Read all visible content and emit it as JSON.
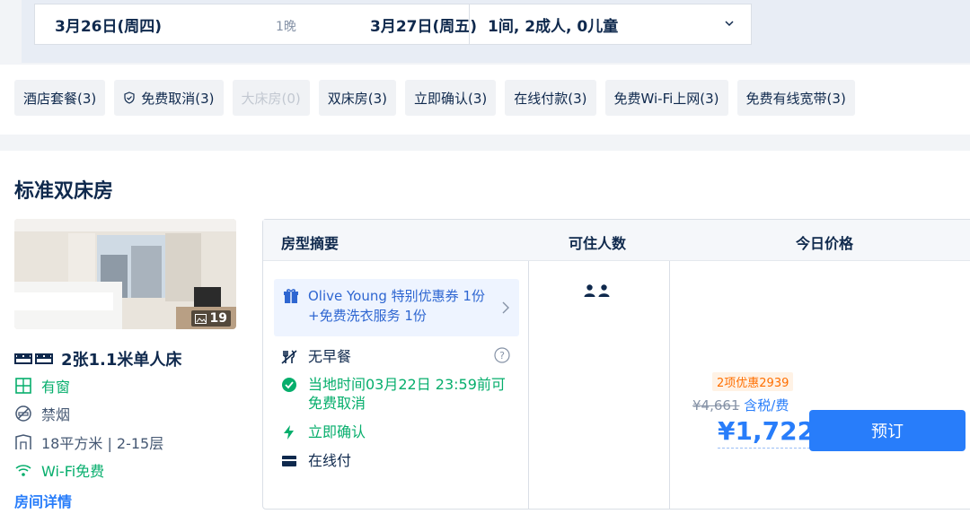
{
  "search": {
    "checkin": "3月26日(周四)",
    "nights": "1晚",
    "checkout": "3月27日(周五)",
    "guests": "1间, 2成人, 0儿童"
  },
  "filters": [
    {
      "label": "酒店套餐(3)"
    },
    {
      "label": "免费取消(3)",
      "icon": "shield-check-icon"
    },
    {
      "label": "大床房(0)",
      "disabled": true
    },
    {
      "label": "双床房(3)"
    },
    {
      "label": "立即确认(3)"
    },
    {
      "label": "在线付款(3)"
    },
    {
      "label": "免费Wi-Fi上网(3)"
    },
    {
      "label": "免费有线宽带(3)"
    }
  ],
  "room": {
    "title": "标准双床房",
    "photo_count": "19",
    "bed": "2张1.1米单人床",
    "window": "有窗",
    "smoking": "禁烟",
    "size": "18平方米 | 2-15层",
    "wifi": "Wi-Fi免费",
    "details_link": "房间详情"
  },
  "table": {
    "headers": {
      "summary": "房型摘要",
      "occupancy": "可住人数",
      "price": "今日价格"
    },
    "promo": "Olive Young 特别优惠券 1份+免费洗衣服务 1份",
    "breakfast": "无早餐",
    "cancel": "当地时间03月22日 23:59前可免费取消",
    "confirm": "立即确认",
    "payment": "在线付",
    "discount": "2项优惠2939",
    "original_price": "¥4,661",
    "tax_note": "含税/费",
    "final_price": "¥1,722",
    "book": "预订"
  },
  "colors": {
    "accent": "#287dfa",
    "green": "#06ae6c",
    "orange": "#ff6f00"
  }
}
